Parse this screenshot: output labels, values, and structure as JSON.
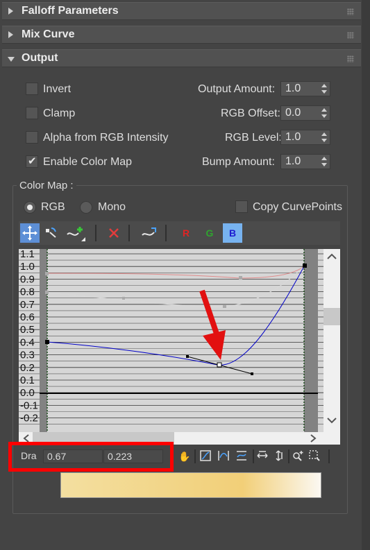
{
  "rollouts": {
    "falloff": "Falloff Parameters",
    "mix": "Mix Curve",
    "output": "Output"
  },
  "output": {
    "invert": "Invert",
    "clamp": "Clamp",
    "alpha_rgb": "Alpha from RGB Intensity",
    "enable_color_map": "Enable Color Map",
    "output_amount_label": "Output Amount:",
    "output_amount": "1.0",
    "rgb_offset_label": "RGB Offset:",
    "rgb_offset": "0.0",
    "rgb_level_label": "RGB Level:",
    "rgb_level": "1.0",
    "bump_amount_label": "Bump Amount:",
    "bump_amount": "1.0"
  },
  "color_map": {
    "group_label": "Color Map :",
    "rgb": "RGB",
    "mono": "Mono",
    "copy_points": "Copy CurvePoints",
    "channel_r": "R",
    "channel_g": "G",
    "channel_b": "B",
    "y_ticks": [
      "1.1",
      "1.0",
      "0.9",
      "0.8",
      "0.7",
      "0.6",
      "0.5",
      "0.4",
      "0.3",
      "0.2",
      "0.1",
      "0.0",
      "-0.1",
      "-0.2"
    ],
    "status_label": "Dra",
    "x_value": "0.67",
    "y_value": "0.223"
  },
  "colors": {
    "panel": "#444444",
    "highlight": "#ff0000",
    "blue_curve": "#0000c8",
    "gradient_start": "#f3dfa0",
    "gradient_mid": "#f2cf78",
    "gradient_end": "#fbf8f2"
  },
  "icons": [
    "move-icon",
    "scale-point-icon",
    "insert-point-icon",
    "delete-icon",
    "reset-curve-icon",
    "pan-icon",
    "zoom-extents-icon",
    "zoom-horizontal-icon",
    "zoom-vertical-icon",
    "zoom-icon",
    "zoom-region-icon"
  ]
}
